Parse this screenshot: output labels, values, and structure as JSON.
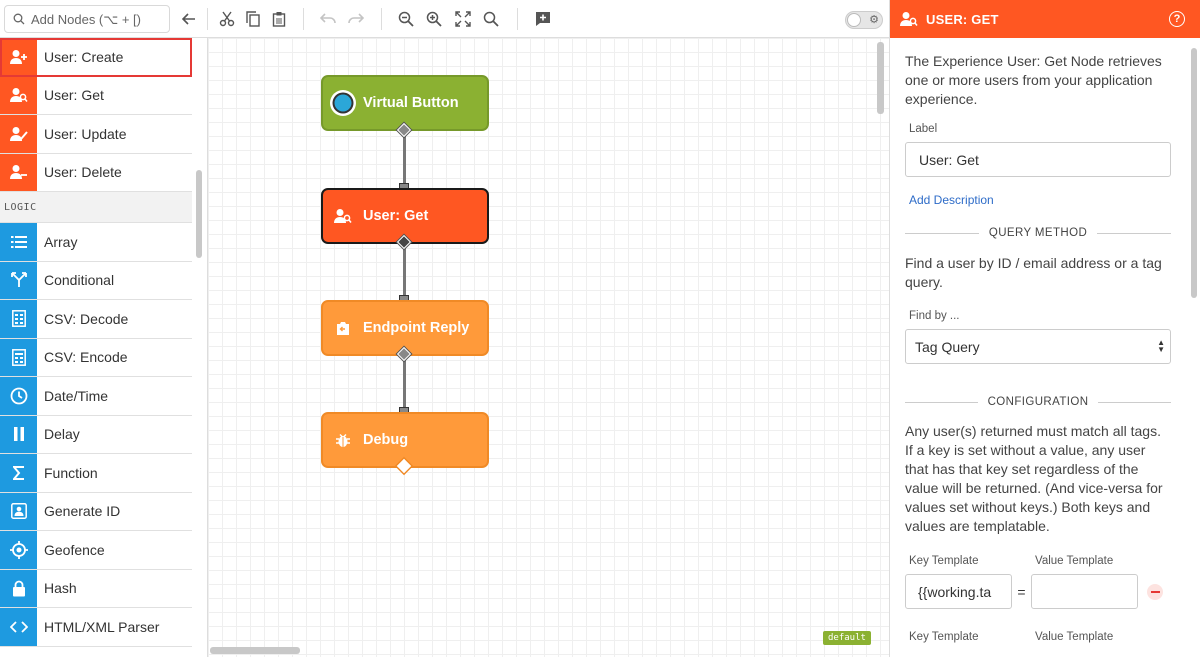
{
  "toolbar": {
    "search_placeholder": "Add Nodes (⌥ + [)",
    "toggle_icon": "gear-icon"
  },
  "palette": {
    "user_items": [
      {
        "label": "User: Create",
        "icon": "user-add-icon"
      },
      {
        "label": "User: Get",
        "icon": "user-search-icon"
      },
      {
        "label": "User: Update",
        "icon": "user-edit-icon"
      },
      {
        "label": "User: Delete",
        "icon": "user-remove-icon"
      }
    ],
    "logic_category": "LOGIC",
    "logic_items": [
      {
        "label": "Array",
        "icon": "list-icon"
      },
      {
        "label": "Conditional",
        "icon": "branch-icon"
      },
      {
        "label": "CSV: Decode",
        "icon": "csv-decode-icon"
      },
      {
        "label": "CSV: Encode",
        "icon": "csv-encode-icon"
      },
      {
        "label": "Date/Time",
        "icon": "clock-icon"
      },
      {
        "label": "Delay",
        "icon": "pause-icon"
      },
      {
        "label": "Function",
        "icon": "sigma-icon"
      },
      {
        "label": "Generate ID",
        "icon": "id-card-icon"
      },
      {
        "label": "Geofence",
        "icon": "target-icon"
      },
      {
        "label": "Hash",
        "icon": "lock-icon"
      },
      {
        "label": "HTML/XML Parser",
        "icon": "code-icon"
      }
    ]
  },
  "canvas": {
    "nodes": [
      {
        "label": "Virtual Button"
      },
      {
        "label": "User: Get"
      },
      {
        "label": "Endpoint Reply"
      },
      {
        "label": "Debug"
      }
    ],
    "tab_label": "default"
  },
  "panel": {
    "header_title": "USER: GET",
    "description": "The Experience User: Get Node retrieves one or more users from your application experience.",
    "label_caption": "Label",
    "label_value": "User: Get",
    "add_description": "Add Description",
    "query_section": "QUERY METHOD",
    "query_text": "Find a user by ID / email address or a tag query.",
    "find_by_caption": "Find by ...",
    "find_by_value": "Tag Query",
    "config_section": "CONFIGURATION",
    "config_text": "Any user(s) returned must match all tags. If a key is set without a value, any user that has that key set regardless of the value will be returned. (And vice-versa for values set without keys.) Both keys and values are templatable.",
    "key_template_caption": "Key Template",
    "value_template_caption": "Value Template",
    "key_value": "{{working.ta",
    "value_value": "",
    "equals": "=",
    "key_template_caption_2": "Key Template",
    "value_template_caption_2": "Value Template"
  },
  "colors": {
    "accent_user": "#ff5722",
    "accent_logic": "#1e9ae0",
    "node_trigger": "#8bb132",
    "node_output": "#ff9a3a"
  }
}
